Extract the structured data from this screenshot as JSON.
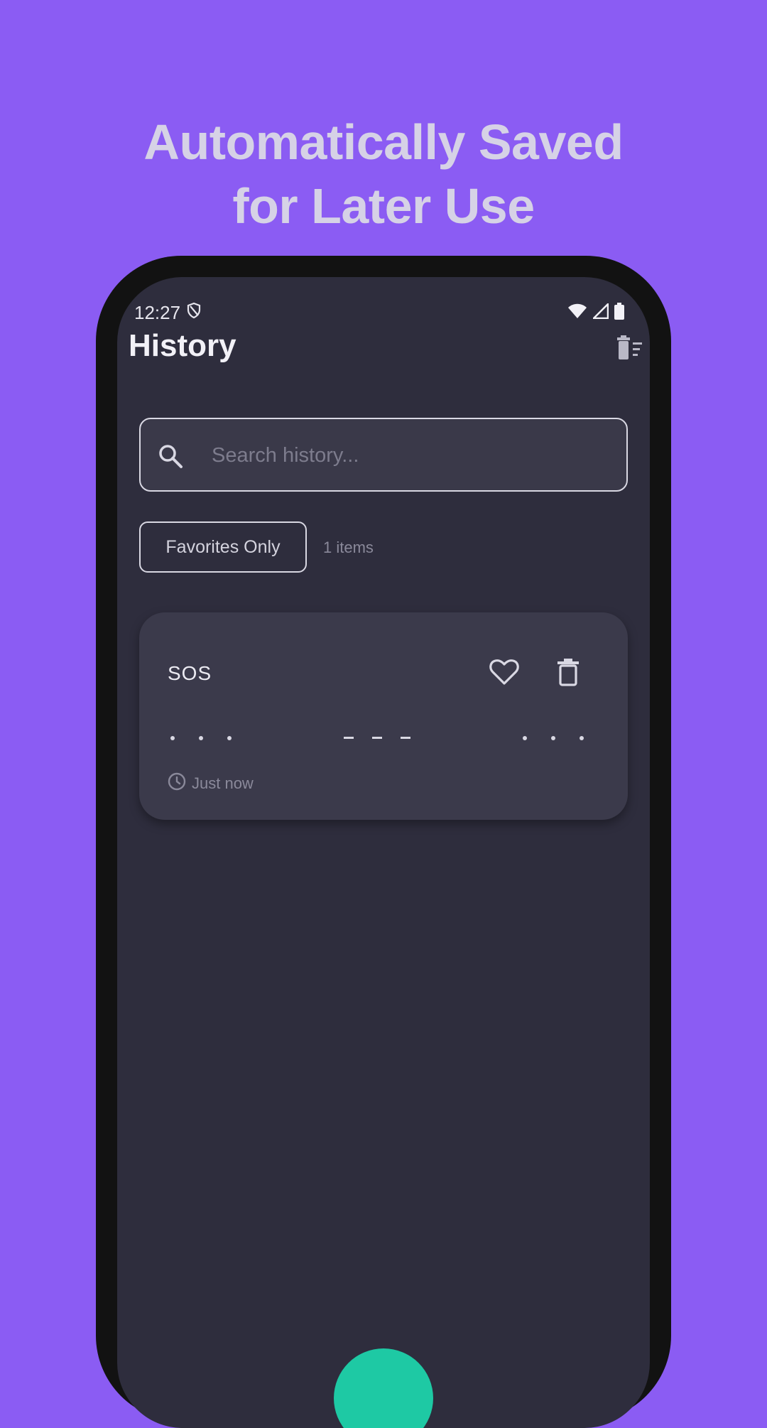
{
  "headline": {
    "line1": "Automatically Saved",
    "line2": "for Later Use"
  },
  "status_bar": {
    "time": "12:27"
  },
  "app_bar": {
    "title": "History",
    "clear_icon": "delete-sweep-icon"
  },
  "search": {
    "placeholder": "Search history...",
    "value": ""
  },
  "filter": {
    "chip_label": "Favorites Only",
    "count_text": "1 items"
  },
  "history_items": [
    {
      "text": "SOS",
      "morse": ". . .   - - -   . . .",
      "time": "Just now",
      "favorite": false
    }
  ],
  "colors": {
    "background": "#8b5cf3",
    "screen": "#2e2d3d",
    "card": "#3b3a4b",
    "accent": "#1ec9a4"
  }
}
